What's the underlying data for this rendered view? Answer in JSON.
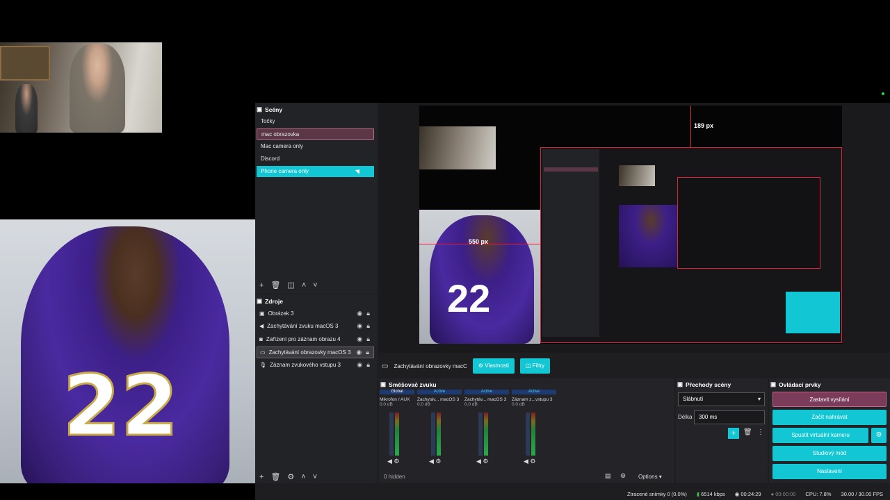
{
  "scenes": {
    "title": "Scény",
    "items": [
      {
        "label": "Točky",
        "state": "normal"
      },
      {
        "label": "mac obrazovka",
        "state": "selected"
      },
      {
        "label": "Mac camera only",
        "state": "normal"
      },
      {
        "label": "Discord",
        "state": "normal"
      },
      {
        "label": "Phone camera only",
        "state": "hover"
      }
    ]
  },
  "sources": {
    "title": "Zdroje",
    "items": [
      {
        "label": "Obrázek 3",
        "icon": "image-icon"
      },
      {
        "label": "Zachytávání zvuku macOS 3",
        "icon": "speaker-icon"
      },
      {
        "label": "Zařízení pro záznam obrazu 4",
        "icon": "camera-icon"
      },
      {
        "label": "Zachytávání obrazovky macOS 3",
        "icon": "monitor-icon"
      },
      {
        "label": "Záznam zvukového vstupu 3",
        "icon": "microphone-icon"
      }
    ]
  },
  "preview": {
    "measure_top": "189 px",
    "measure_left": "550 px"
  },
  "props_bar": {
    "source_name": "Zachytávání obrazovky macC",
    "properties": "Vlastnosti",
    "filters": "Filtry"
  },
  "mixer": {
    "title": "Směšovač zvuku",
    "tabs": [
      "Global",
      "Active",
      "Active",
      "Active"
    ],
    "channels": [
      {
        "name": "Mikrofon / AUX",
        "db": "0.0 dB"
      },
      {
        "name": "Zachytáv... macOS 3",
        "db": "0.0 dB"
      },
      {
        "name": "Zachytáv... macOS 3",
        "db": "0.0 dB"
      },
      {
        "name": "Záznam z...vstupu 3",
        "db": "0.0 dB"
      }
    ],
    "hidden": "0 hidden",
    "options": "Options"
  },
  "transitions": {
    "title": "Přechody scény",
    "selected": "Slábnutí",
    "duration_label": "Délka",
    "duration_value": "300 ms"
  },
  "controls": {
    "title": "Ovládací prvky",
    "buttons": [
      "Zastavit vysílání",
      "Začít nahrávat",
      "Spustit virtuální kameru",
      "Studiový mód",
      "Nastavení"
    ]
  },
  "status": {
    "dropped": "Ztracené snímky 0 (0.0%)",
    "bitrate": "6514 kbps",
    "live_time": "00:24:29",
    "rec_time": "00:00:00",
    "cpu": "CPU: 7.8%",
    "fps": "30.00 / 30.00 FPS"
  },
  "colors": {
    "accent": "#12c6d4",
    "selected_scene": "#5b3745",
    "stop_button": "#7a3c5a",
    "panel_bg": "#242428"
  }
}
